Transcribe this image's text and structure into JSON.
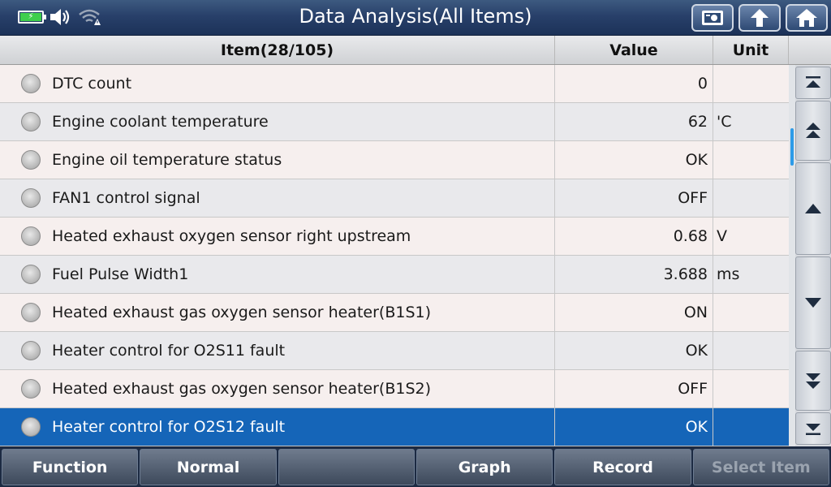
{
  "header": {
    "title": "Data Analysis(All Items)",
    "battery_icon": "battery-charging-icon",
    "volume_icon": "speaker-icon",
    "wifi_icon": "wifi-warning-icon",
    "buttons": [
      {
        "name": "screenshot-button",
        "icon": "camera-screen-icon"
      },
      {
        "name": "back-button",
        "icon": "arrow-up-back-icon"
      },
      {
        "name": "home-button",
        "icon": "home-icon"
      }
    ]
  },
  "table": {
    "headers": {
      "item": "Item(28/105)",
      "value": "Value",
      "unit": "Unit"
    },
    "rows": [
      {
        "item": "DTC count",
        "value": "0",
        "unit": ""
      },
      {
        "item": "Engine coolant temperature",
        "value": "62",
        "unit": "'C"
      },
      {
        "item": "Engine oil temperature status",
        "value": "OK",
        "unit": ""
      },
      {
        "item": "FAN1 control signal",
        "value": "OFF",
        "unit": ""
      },
      {
        "item": "Heated exhaust oxygen sensor right upstream",
        "value": "0.68",
        "unit": "V"
      },
      {
        "item": "Fuel Pulse Width1",
        "value": "3.688",
        "unit": "ms"
      },
      {
        "item": "Heated exhaust gas oxygen sensor heater(B1S1)",
        "value": "ON",
        "unit": ""
      },
      {
        "item": "Heater control for O2S11 fault",
        "value": "OK",
        "unit": ""
      },
      {
        "item": "Heated exhaust gas oxygen sensor heater(B1S2)",
        "value": "OFF",
        "unit": ""
      },
      {
        "item": "Heater control for O2S12 fault",
        "value": "OK",
        "unit": ""
      }
    ],
    "selected_index": 9
  },
  "scroll": {
    "buttons": [
      "scroll-top-icon",
      "page-up-icon",
      "line-up-icon",
      "line-down-icon",
      "page-down-icon",
      "scroll-bottom-icon"
    ]
  },
  "footer": {
    "function": "Function",
    "normal": "Normal",
    "blank": "",
    "graph": "Graph",
    "record": "Record",
    "select_item": "Select Item"
  },
  "colors": {
    "selected_row": "#1565b8",
    "accent_scroll": "#2d9be8",
    "title_bar": "#28406a"
  }
}
